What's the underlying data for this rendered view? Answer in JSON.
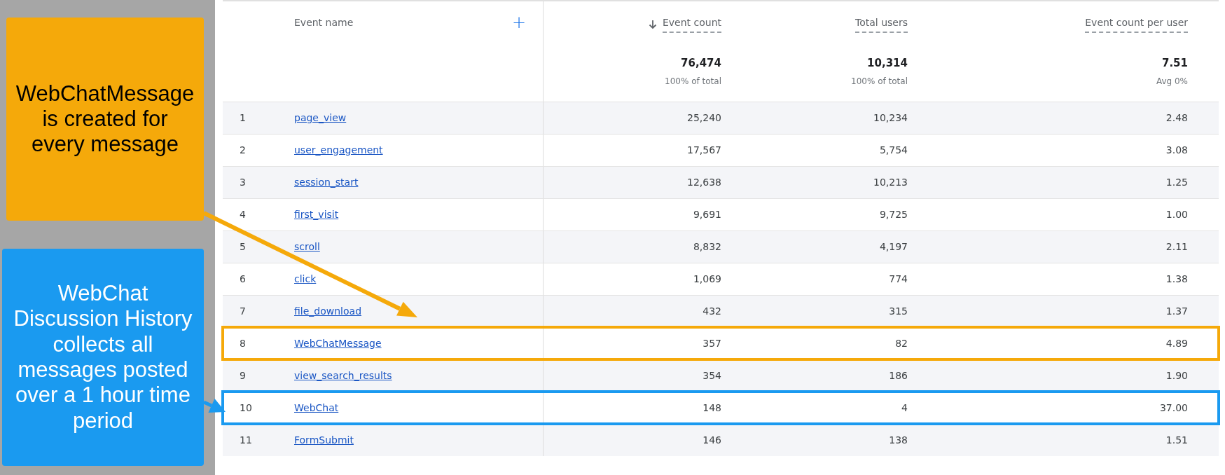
{
  "annotations": [
    {
      "text": "WebChatMessage is created for every message",
      "color": "#f5a90a"
    },
    {
      "text": "WebChat Discussion History collects all messages posted over a 1 hour time period",
      "color": "#1a9af0"
    }
  ],
  "table": {
    "add_column_icon": "+",
    "columns": [
      {
        "label": "Event name"
      },
      {
        "label": "Event count",
        "sorted": true
      },
      {
        "label": "Total users",
        "sorted": false
      },
      {
        "label": "Event count per user",
        "sorted": false
      }
    ],
    "totals": [
      {
        "value": "76,474",
        "note": "100% of total"
      },
      {
        "value": "10,314",
        "note": "100% of total"
      },
      {
        "value": "7.51",
        "note": "Avg 0%"
      }
    ],
    "rows": [
      {
        "index": "1",
        "event": "page_view",
        "event_count": "25,240",
        "total_users": "10,234",
        "per_user": "2.48"
      },
      {
        "index": "2",
        "event": "user_engagement",
        "event_count": "17,567",
        "total_users": "5,754",
        "per_user": "3.08"
      },
      {
        "index": "3",
        "event": "session_start",
        "event_count": "12,638",
        "total_users": "10,213",
        "per_user": "1.25"
      },
      {
        "index": "4",
        "event": "first_visit",
        "event_count": "9,691",
        "total_users": "9,725",
        "per_user": "1.00"
      },
      {
        "index": "5",
        "event": "scroll",
        "event_count": "8,832",
        "total_users": "4,197",
        "per_user": "2.11"
      },
      {
        "index": "6",
        "event": "click",
        "event_count": "1,069",
        "total_users": "774",
        "per_user": "1.38"
      },
      {
        "index": "7",
        "event": "file_download",
        "event_count": "432",
        "total_users": "315",
        "per_user": "1.37"
      },
      {
        "index": "8",
        "event": "WebChatMessage",
        "event_count": "357",
        "total_users": "82",
        "per_user": "4.89",
        "color": "#f5a90a"
      },
      {
        "index": "9",
        "event": "view_search_results",
        "event_count": "354",
        "total_users": "186",
        "per_user": "1.90"
      },
      {
        "index": "10",
        "event": "WebChat",
        "event_count": "148",
        "total_users": "4",
        "per_user": "37.00",
        "color": "#1a9af0"
      },
      {
        "index": "11",
        "event": "FormSubmit",
        "event_count": "146",
        "total_users": "138",
        "per_user": "1.51"
      }
    ]
  }
}
